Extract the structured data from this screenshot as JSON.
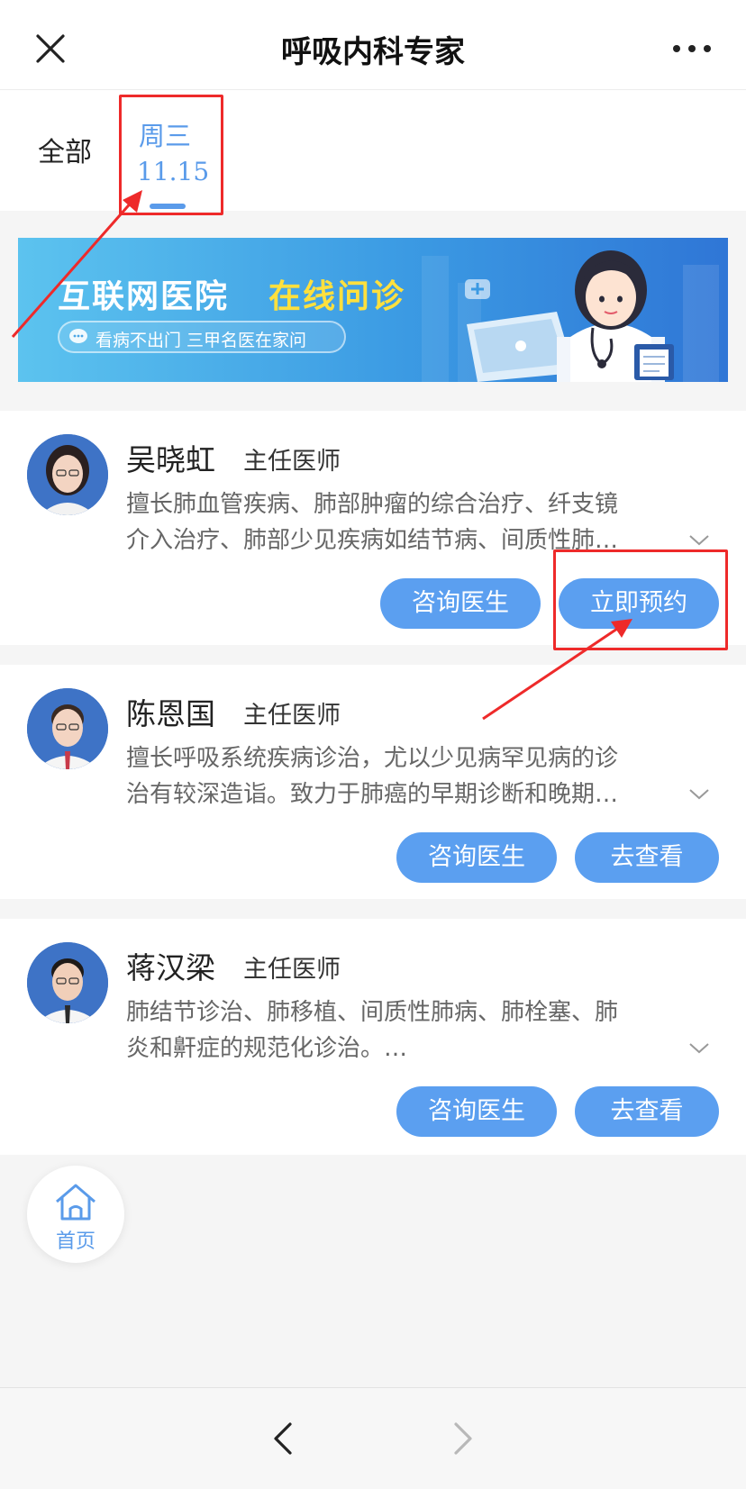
{
  "header": {
    "title": "呼吸内科专家",
    "close_icon": "close-icon",
    "more_icon": "more-icon"
  },
  "tabs": {
    "all_label": "全部",
    "selected": {
      "day": "周三",
      "date": "11.15"
    }
  },
  "banner": {
    "title": "互联网医院",
    "accent": "在线问诊",
    "slogan": "看病不出门  三甲名医在家问",
    "accent_color": "#ffe03d"
  },
  "doctors": [
    {
      "name": "吴晓虹",
      "title": "主任医师",
      "desc_line1": "擅长肺血管疾病、肺部肿瘤的综合治疗、纤支镜",
      "desc_line2": "介入治疗、肺部少见疾病如结节病、间质性肺…",
      "consult_label": "咨询医生",
      "action_label": "立即预约"
    },
    {
      "name": "陈恩国",
      "title": "主任医师",
      "desc_line1": "擅长呼吸系统疾病诊治，尤以少见病罕见病的诊",
      "desc_line2": "治有较深造诣。致力于肺癌的早期诊断和晚期…",
      "consult_label": "咨询医生",
      "action_label": "去查看"
    },
    {
      "name": "蒋汉梁",
      "title": "主任医师",
      "desc_line1": "肺结节诊治、肺移植、间质性肺病、肺栓塞、肺",
      "desc_line2": "炎和鼾症的规范化诊治。…",
      "consult_label": "咨询医生",
      "action_label": "去查看"
    }
  ],
  "home": {
    "label": "首页",
    "icon": "home-icon"
  },
  "colors": {
    "accent": "#5b9ff0",
    "annotation": "#ee2a2a"
  }
}
